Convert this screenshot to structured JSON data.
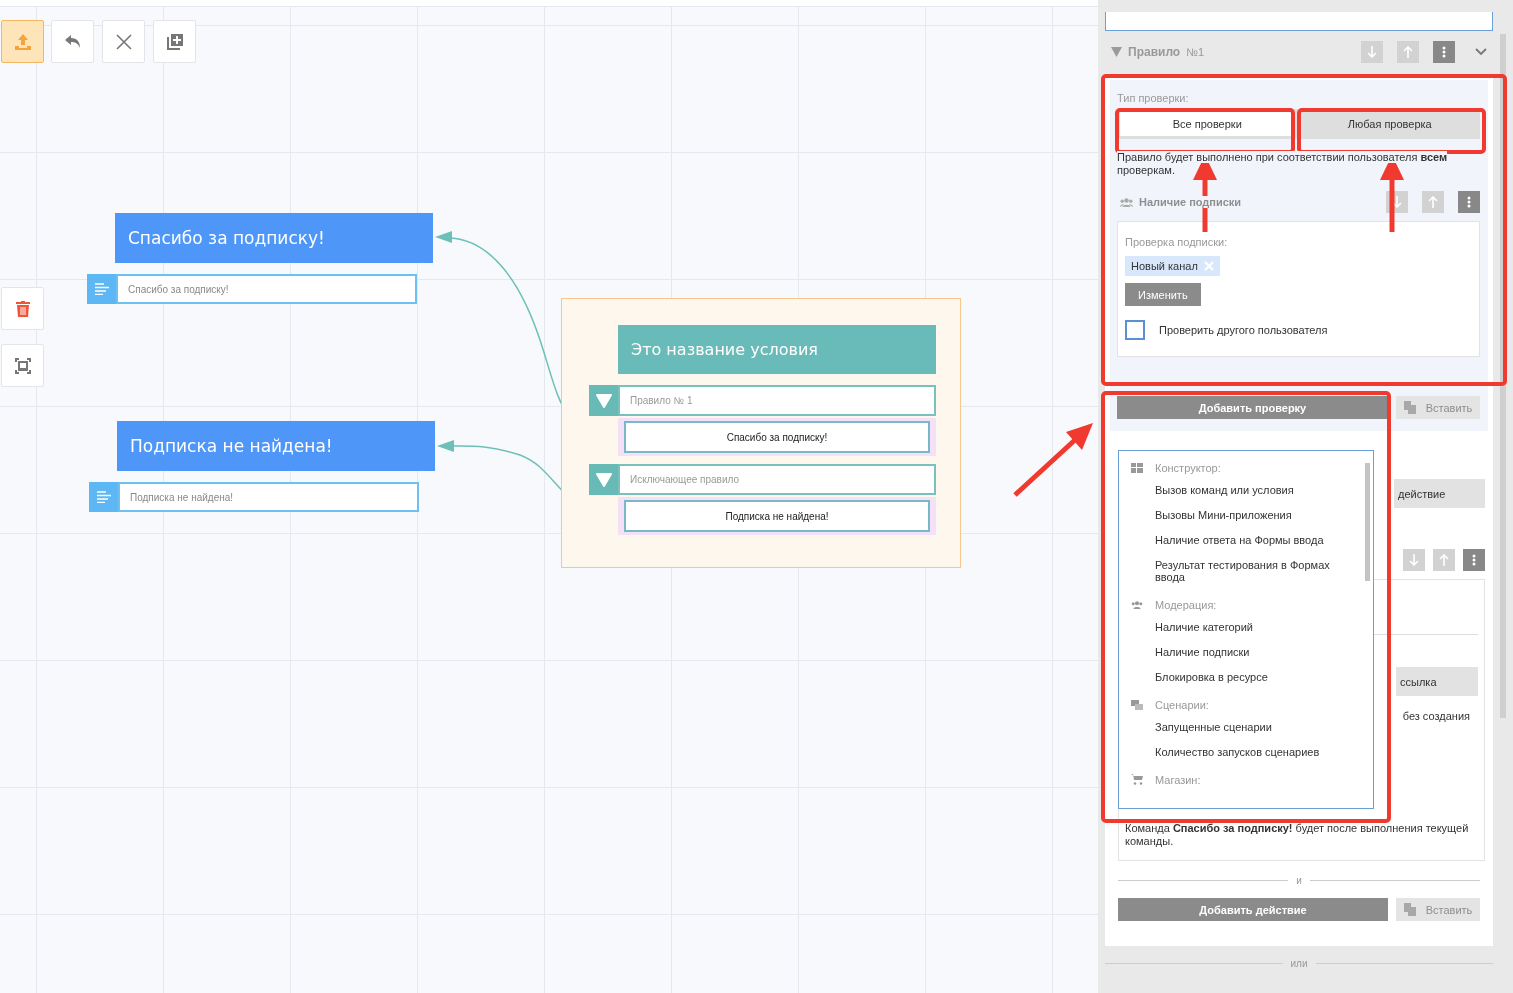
{
  "toolbar": [
    {
      "kind": "upload",
      "selected": true
    },
    {
      "kind": "undo",
      "selected": false
    },
    {
      "kind": "close",
      "selected": false
    },
    {
      "kind": "add",
      "selected": false
    }
  ],
  "side_tools": [
    {
      "kind": "delete"
    },
    {
      "kind": "fit"
    }
  ],
  "messages": [
    {
      "title": "Спасибо за подписку!",
      "text": "Спасибо за подписку!"
    },
    {
      "title": "Подписка не найдена!",
      "text": "Подписка не найдена!"
    }
  ],
  "condition": {
    "title": "Это название условия",
    "rules": [
      {
        "label": "Правило № 1",
        "target": "Спасибо за подписку!"
      },
      {
        "label": "Исключающее правило",
        "target": "Подписка не найдена!"
      }
    ]
  },
  "panel": {
    "rule": {
      "label": "Правило",
      "number": "№1"
    },
    "check_type": {
      "label": "Тип проверки:",
      "options": [
        {
          "label": "Все проверки",
          "selected": true
        },
        {
          "label": "Любая проверка",
          "selected": false
        }
      ]
    },
    "description": "Правило будет выполнено при соответствии пользователя **всем** проверкам.",
    "check": {
      "title": "Наличие подписки",
      "field_label": "Проверка подписки:",
      "tags": [
        "Новый канал"
      ],
      "change_button": "Изменить",
      "checkbox": {
        "label": "Проверить другого пользователя",
        "checked": false
      }
    },
    "add_check_button": "Добавить проверку",
    "paste_button": {
      "label": "Вставить",
      "disabled": true
    },
    "dropdown": {
      "groups": [
        {
          "kind": "grid",
          "title": "Конструктор:",
          "items": [
            "Вызов команд или условия",
            "Вызовы Мини-приложения",
            "Наличие ответа на Формы ввода",
            "Результат тестирования в Формах ввода"
          ]
        },
        {
          "kind": "users",
          "title": "Модерация:",
          "items": [
            "Наличие категорий",
            "Наличие подписки",
            "Блокировка в ресурсе"
          ]
        },
        {
          "kind": "scenario",
          "title": "Сценарии:",
          "items": [
            "Запущенные сценарии",
            "Количество запусков сценариев"
          ]
        },
        {
          "kind": "cart",
          "title": "Магазин:"
        }
      ]
    },
    "behind_dropdown": {
      "button": "действие",
      "button_2": "ссылка",
      "text": "без создания"
    },
    "note": "Команда **Спасибо за подписку!** будет после выполнения текущей команды.",
    "divider_and": "и",
    "add_action_button": "Добавить действие",
    "paste_button_2": {
      "label": "Вставить",
      "disabled": true
    },
    "divider_or": "или"
  }
}
